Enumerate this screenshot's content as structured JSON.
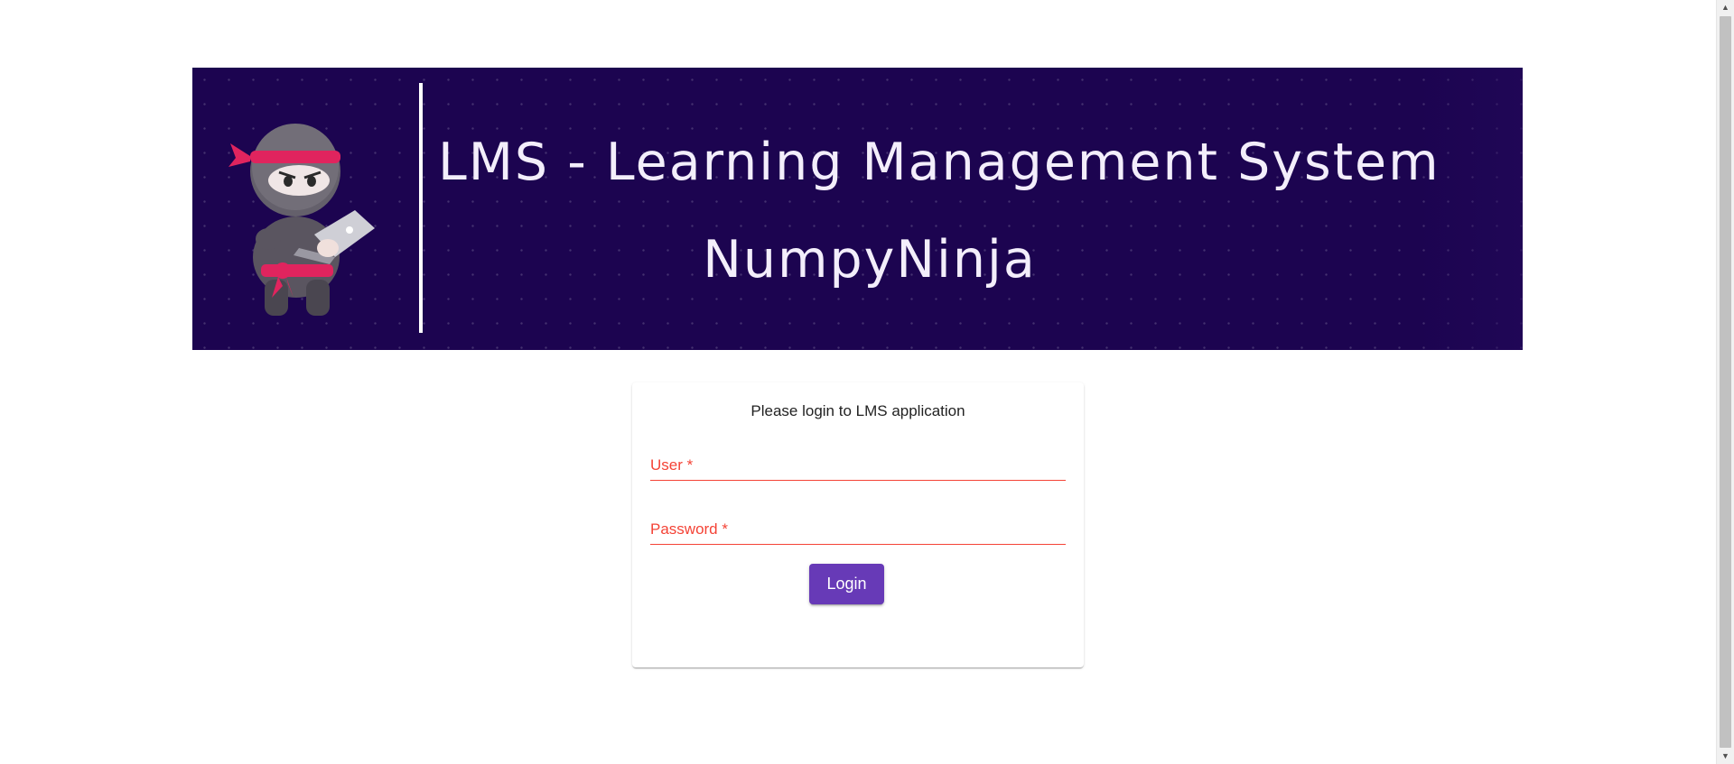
{
  "banner": {
    "title": "LMS - Learning Management System",
    "subtitle": "NumpyNinja",
    "logo_icon": "ninja-mascot-icon",
    "background_color": "#1c0450"
  },
  "login": {
    "heading": "Please login to LMS application",
    "user_label": "User *",
    "user_value": "",
    "password_label": "Password *",
    "password_value": "",
    "button_label": "Login",
    "accent_color": "#673ab7",
    "error_color": "#f44336"
  },
  "scrollbar": {
    "up_icon": "triangle-up-icon",
    "down_icon": "triangle-down-icon"
  }
}
